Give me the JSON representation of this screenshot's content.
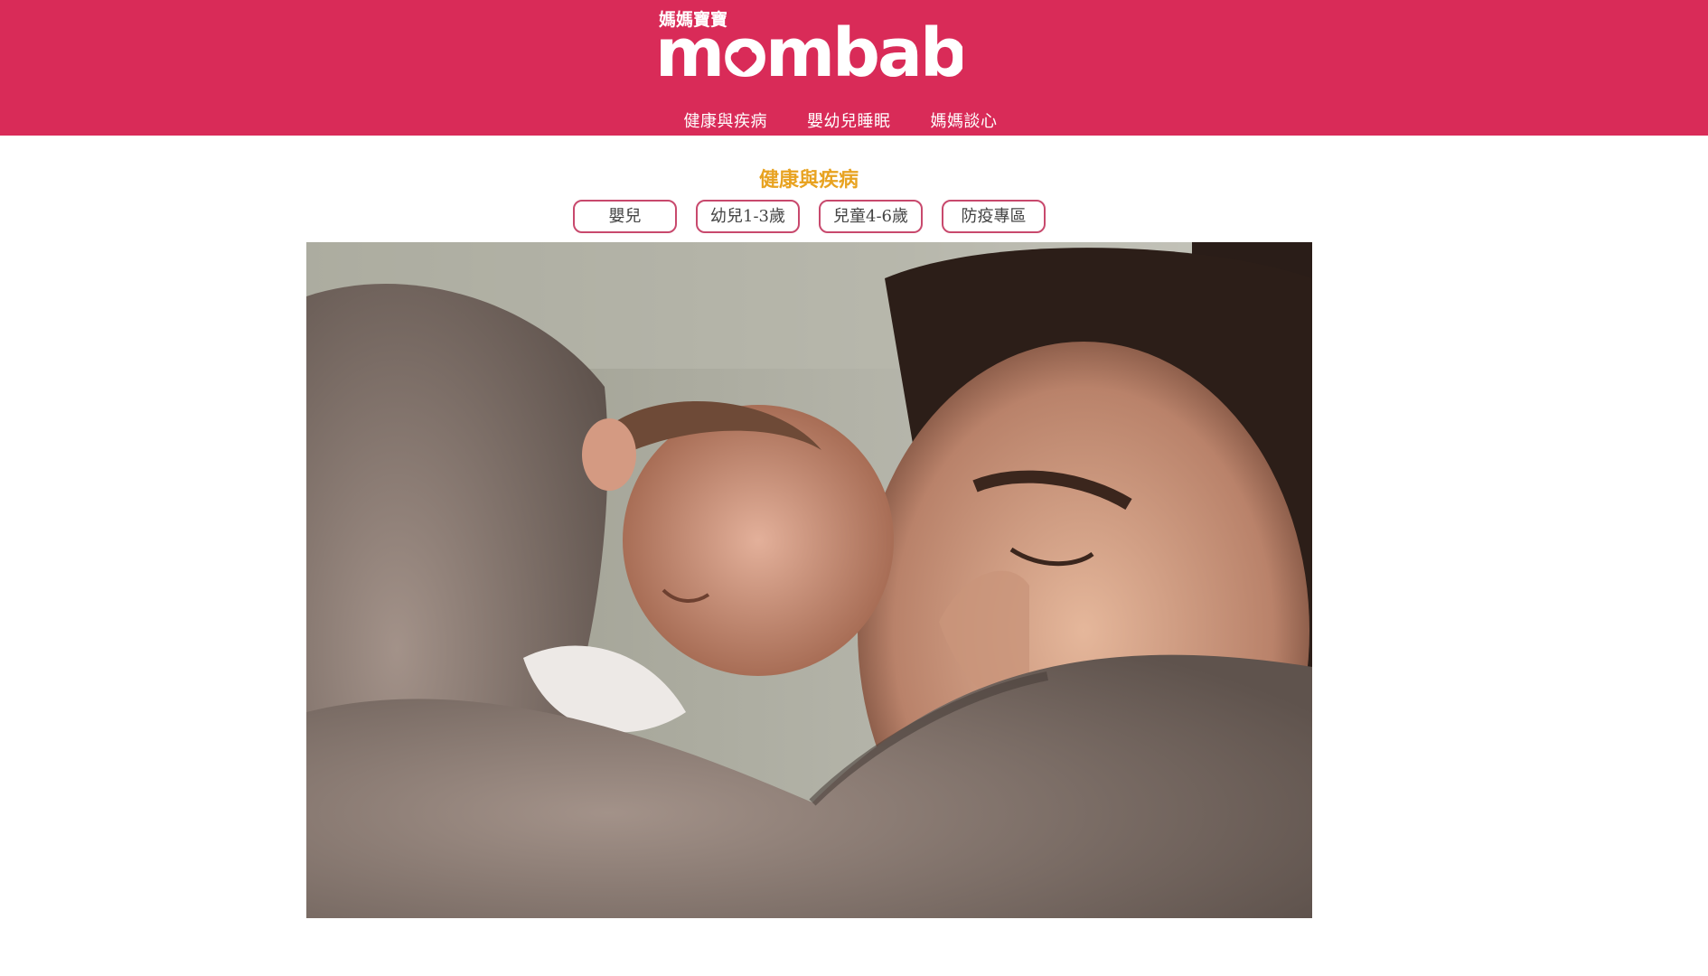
{
  "brand": {
    "logo_small_text": "媽媽寶寶",
    "logo_text": "mombaby",
    "primary_color": "#d92b58",
    "accent_color": "#e8a321"
  },
  "nav": {
    "items": [
      {
        "label": "健康與疾病"
      },
      {
        "label": "嬰幼兒睡眠"
      },
      {
        "label": "媽媽談心"
      }
    ]
  },
  "section": {
    "title": "健康與疾病",
    "tabs": [
      {
        "label": "嬰兒"
      },
      {
        "label": "幼兒1-3歲"
      },
      {
        "label": "兒童4-6歲"
      },
      {
        "label": "防疫專區"
      }
    ]
  },
  "hero": {
    "image_icon": "photo-icon"
  }
}
